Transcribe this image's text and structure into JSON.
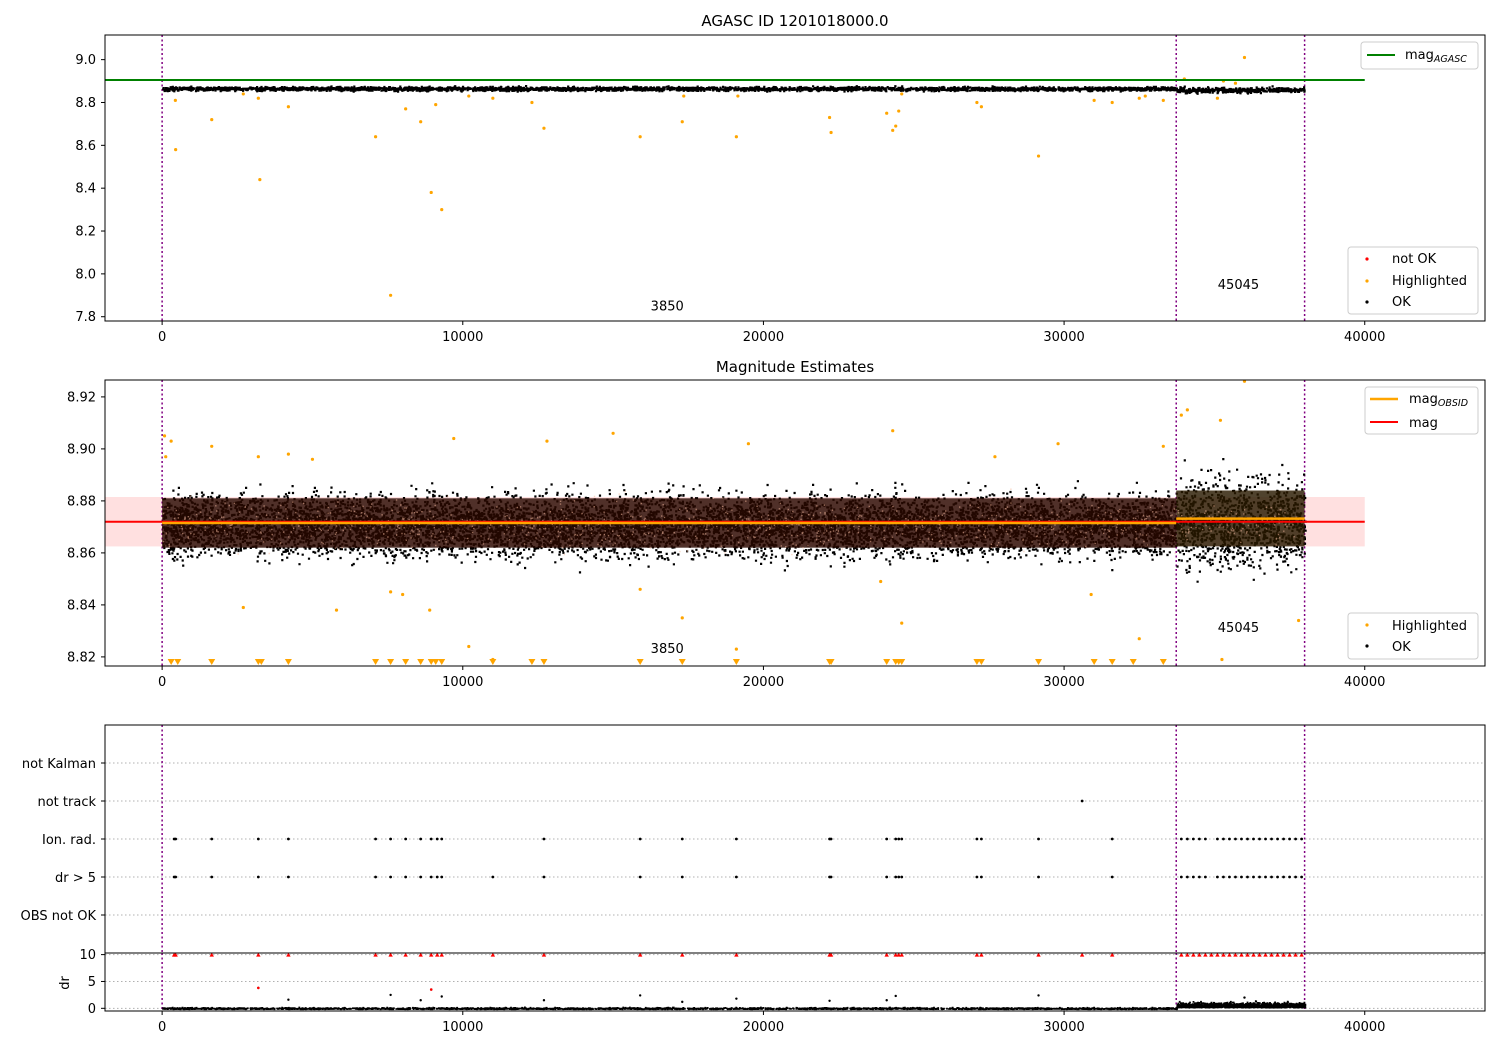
{
  "figure": {
    "colors": {
      "ok": "#000000",
      "highlighted": "#ffa500",
      "not_ok": "#ff0000",
      "mag_agasc": "#008000",
      "mag_obsid": "#ffa500",
      "mag": "#ff0000",
      "band": "#ffcccc",
      "obs_marker": "#800080",
      "grid": "#b0b0b0"
    }
  },
  "chart_data": [
    {
      "type": "scatter",
      "title": "AGASC ID 1201018000.0",
      "xlim": [
        -1900,
        44000
      ],
      "ylim": [
        7.78,
        9.115
      ],
      "x_ticks": [
        0,
        10000,
        20000,
        30000,
        40000
      ],
      "y_ticks": [
        7.8,
        8.0,
        8.2,
        8.4,
        8.6,
        8.8,
        9.0
      ],
      "y_tick_labels": [
        "7.8",
        "8.0",
        "8.2",
        "8.4",
        "8.6",
        "8.8",
        "9.0"
      ],
      "obs_boundaries": [
        0,
        33730,
        38000
      ],
      "obsid_labels": [
        {
          "x": 16800,
          "y": 7.83,
          "text": "3850"
        },
        {
          "x": 35800,
          "y": 7.93,
          "text": "45045"
        }
      ],
      "lines": [
        {
          "name": "mag_AGASC",
          "y": 8.905,
          "x": [
            -1900,
            40000
          ],
          "color": "#008000"
        }
      ],
      "ok_band": [
        {
          "x": [
            0,
            33730
          ],
          "center": 8.868,
          "spread": 0.01
        },
        {
          "x": [
            33730,
            38000
          ],
          "center": 8.862,
          "spread": 0.013
        }
      ],
      "highlighted_points": [
        [
          440,
          8.81
        ],
        [
          450,
          8.58
        ],
        [
          1650,
          8.72
        ],
        [
          2700,
          8.84
        ],
        [
          3200,
          8.82
        ],
        [
          3250,
          8.44
        ],
        [
          4200,
          8.78
        ],
        [
          7100,
          8.64
        ],
        [
          8100,
          8.77
        ],
        [
          8600,
          8.71
        ],
        [
          8950,
          8.38
        ],
        [
          9100,
          8.79
        ],
        [
          9300,
          8.3
        ],
        [
          7600,
          7.9
        ],
        [
          10200,
          8.83
        ],
        [
          11000,
          8.82
        ],
        [
          12300,
          8.8
        ],
        [
          12700,
          8.68
        ],
        [
          15900,
          8.64
        ],
        [
          17300,
          8.71
        ],
        [
          17350,
          8.83
        ],
        [
          19100,
          8.64
        ],
        [
          19150,
          8.83
        ],
        [
          22200,
          8.73
        ],
        [
          22250,
          8.66
        ],
        [
          24100,
          8.75
        ],
        [
          24300,
          8.67
        ],
        [
          24400,
          8.69
        ],
        [
          24500,
          8.76
        ],
        [
          24600,
          8.84
        ],
        [
          27100,
          8.8
        ],
        [
          27250,
          8.78
        ],
        [
          29150,
          8.55
        ],
        [
          31000,
          8.81
        ],
        [
          31600,
          8.8
        ],
        [
          32500,
          8.82
        ],
        [
          32700,
          8.83
        ],
        [
          33300,
          8.81
        ],
        [
          35100,
          8.82
        ],
        [
          35300,
          8.9
        ],
        [
          35700,
          8.89
        ],
        [
          36000,
          9.01
        ],
        [
          34000,
          8.91
        ]
      ],
      "not_ok_points": [],
      "legend_lines": [
        {
          "label": "mag",
          "subscript": "AGASC"
        }
      ],
      "legend_points": [
        "not OK",
        "Highlighted",
        "OK"
      ]
    },
    {
      "type": "scatter",
      "title": "Magnitude Estimates",
      "xlim": [
        -1900,
        44000
      ],
      "ylim": [
        8.8165,
        8.9265
      ],
      "x_ticks": [
        0,
        10000,
        20000,
        30000,
        40000
      ],
      "x_tick_labels": [
        "0",
        "10000",
        "20000",
        "30000",
        "40000"
      ],
      "y_ticks": [
        8.82,
        8.84,
        8.86,
        8.88,
        8.9,
        8.92
      ],
      "y_tick_labels": [
        "8.82",
        "8.84",
        "8.86",
        "8.88",
        "8.90",
        "8.92"
      ],
      "obs_boundaries": [
        0,
        33730,
        38000
      ],
      "obsid_labels": [
        {
          "x": 16800,
          "y": 8.8215,
          "text": "3850"
        },
        {
          "x": 35800,
          "y": 8.8295,
          "text": "45045"
        }
      ],
      "mag_band": {
        "y": [
          8.8625,
          8.8815
        ],
        "x": [
          -1900,
          40000
        ]
      },
      "lines": [
        {
          "name": "mag",
          "y": 8.872,
          "x": [
            -1900,
            40000
          ],
          "color": "#ff0000"
        },
        {
          "name": "mag_OBSID",
          "y": 8.8715,
          "x": [
            0,
            33730
          ],
          "color": "#ffa500"
        },
        {
          "name": "mag_OBSID",
          "y": 8.8732,
          "x": [
            33730,
            38000
          ],
          "color": "#ffa500"
        }
      ],
      "obs_bands": [
        {
          "x": [
            0,
            33730
          ],
          "y": [
            8.862,
            8.881
          ],
          "color": "#2a0800"
        },
        {
          "x": [
            33730,
            38000
          ],
          "y": [
            8.8625,
            8.884
          ],
          "color": "#2a1a00"
        }
      ],
      "ok_band": [
        {
          "x": [
            0,
            33730
          ],
          "center": 8.871,
          "spread": 0.0125
        },
        {
          "x": [
            33730,
            38000
          ],
          "center": 8.872,
          "spread": 0.018
        }
      ],
      "highlighted_points": [
        [
          80,
          8.905
        ],
        [
          120,
          8.897
        ],
        [
          300,
          8.903
        ],
        [
          1650,
          8.901
        ],
        [
          2700,
          8.839
        ],
        [
          3200,
          8.897
        ],
        [
          4200,
          8.898
        ],
        [
          5000,
          8.896
        ],
        [
          5800,
          8.838
        ],
        [
          7600,
          8.845
        ],
        [
          8000,
          8.844
        ],
        [
          8900,
          8.838
        ],
        [
          9700,
          8.904
        ],
        [
          10200,
          8.824
        ],
        [
          11000,
          8.819
        ],
        [
          12800,
          8.903
        ],
        [
          15000,
          8.906
        ],
        [
          15900,
          8.846
        ],
        [
          17300,
          8.835
        ],
        [
          19100,
          8.823
        ],
        [
          19500,
          8.902
        ],
        [
          23900,
          8.849
        ],
        [
          24300,
          8.907
        ],
        [
          24600,
          8.833
        ],
        [
          27700,
          8.897
        ],
        [
          29800,
          8.902
        ],
        [
          30900,
          8.844
        ],
        [
          32500,
          8.827
        ],
        [
          33300,
          8.901
        ],
        [
          33900,
          8.913
        ],
        [
          34100,
          8.915
        ],
        [
          35200,
          8.911
        ],
        [
          35250,
          8.819
        ],
        [
          36000,
          8.926
        ],
        [
          37800,
          8.834
        ]
      ],
      "clipped_points_x": [
        300,
        520,
        1650,
        3200,
        3300,
        4200,
        7100,
        7600,
        8100,
        8600,
        8950,
        9100,
        9300,
        11000,
        12300,
        12700,
        15900,
        17300,
        19100,
        22200,
        22250,
        24100,
        24400,
        24500,
        24600,
        27100,
        27250,
        29150,
        31000,
        31600,
        32300,
        33300
      ],
      "legend_lines": [
        {
          "label": "mag",
          "subscript": "OBSID"
        },
        {
          "label": "mag",
          "subscript": ""
        }
      ],
      "legend_points": [
        "Highlighted",
        "OK"
      ]
    },
    {
      "type": "scatter",
      "title": "",
      "xlim": [
        -1900,
        44000
      ],
      "category_labels": [
        "not Kalman",
        "not track",
        "Ion. rad.",
        "dr > 5",
        "OBS not OK"
      ],
      "obs_boundaries": [
        0,
        33730,
        38000
      ],
      "flags": {
        "not Kalman": [],
        "not track": [
          30600
        ],
        "Ion. rad.": [
          400,
          450,
          1650,
          3200,
          4200,
          7100,
          7600,
          8100,
          8600,
          8950,
          9150,
          9300,
          12700,
          15900,
          17300,
          19100,
          22200,
          22250,
          24100,
          24400,
          24500,
          24600,
          27100,
          27250,
          29150,
          31600,
          33900,
          34100,
          34300,
          34500,
          34700,
          35100,
          35300,
          35500,
          35700,
          35900,
          36100,
          36300,
          36500,
          36700,
          36900,
          37100,
          37300,
          37500,
          37700,
          37900
        ],
        "dr > 5": [
          400,
          450,
          1650,
          3200,
          4200,
          7100,
          7600,
          8100,
          8600,
          8950,
          9150,
          9300,
          11000,
          12700,
          15900,
          17300,
          19100,
          22200,
          22250,
          24100,
          24400,
          24500,
          24600,
          27100,
          27250,
          29150,
          31600,
          33900,
          34100,
          34300,
          34500,
          34700,
          35100,
          35300,
          35500,
          35700,
          35900,
          36100,
          36300,
          36500,
          36700,
          36900,
          37100,
          37300,
          37500,
          37700,
          37900
        ],
        "OBS not OK": []
      }
    },
    {
      "type": "scatter",
      "title": "",
      "xlim": [
        -1900,
        44000
      ],
      "ylim": [
        -0.5,
        10.3
      ],
      "ylabel": "dr",
      "y_ticks": [
        0,
        5,
        10
      ],
      "y_tick_labels": [
        "0",
        "5",
        "10"
      ],
      "x_ticks": [
        0,
        10000,
        20000,
        30000,
        40000
      ],
      "x_tick_labels": [
        "0",
        "10000",
        "20000",
        "30000",
        "40000"
      ],
      "obs_boundaries": [
        0,
        33730,
        38000
      ],
      "clipped_x": [
        400,
        450,
        1650,
        3200,
        4200,
        7100,
        7600,
        8100,
        8600,
        8950,
        9150,
        9300,
        11000,
        12700,
        15900,
        17300,
        19100,
        22200,
        22250,
        24100,
        24400,
        24500,
        24600,
        27100,
        27250,
        29150,
        30600,
        31600,
        33900,
        34100,
        34300,
        34500,
        34700,
        34900,
        35100,
        35300,
        35500,
        35700,
        35900,
        36100,
        36300,
        36500,
        36700,
        36900,
        37100,
        37300,
        37500,
        37700,
        37900
      ],
      "outliers": [
        [
          3200,
          3.8
        ],
        [
          7600,
          2.5
        ],
        [
          8600,
          1.5
        ],
        [
          8950,
          3.5
        ],
        [
          9300,
          2.2
        ],
        [
          12700,
          1.5
        ],
        [
          15900,
          2.4
        ],
        [
          17300,
          1.2
        ],
        [
          19100,
          1.8
        ],
        [
          22200,
          1.4
        ],
        [
          24100,
          1.5
        ],
        [
          24400,
          2.3
        ],
        [
          29150,
          2.4
        ],
        [
          4200,
          1.6
        ],
        [
          36000,
          2.0
        ]
      ],
      "not_ok_points": [
        [
          3200,
          3.8
        ],
        [
          8950,
          3.5
        ]
      ]
    }
  ]
}
